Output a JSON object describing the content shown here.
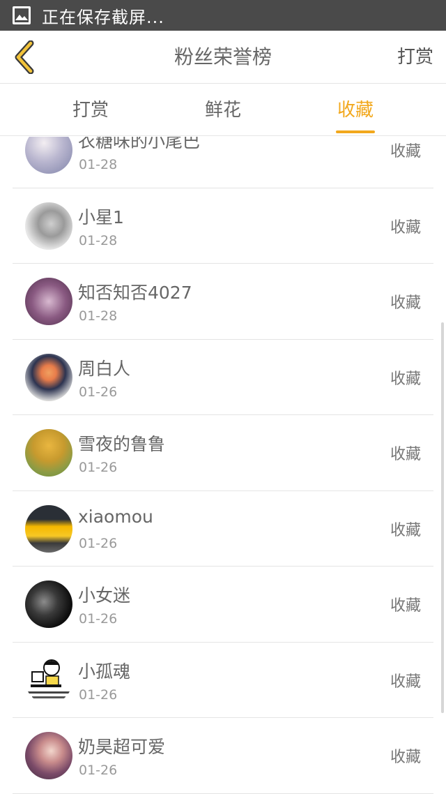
{
  "status_bar": {
    "text": "正在保存截屏...",
    "icon": "screenshot-icon"
  },
  "header": {
    "back_icon": "chevron-left-icon",
    "title": "粉丝荣誉榜",
    "action": "打赏"
  },
  "tabs": [
    {
      "label": "打赏",
      "active": false
    },
    {
      "label": "鲜花",
      "active": false
    },
    {
      "label": "收藏",
      "active": true
    }
  ],
  "colors": {
    "accent": "#f2a81d",
    "status_bar": "#4a4a4a"
  },
  "fans": [
    {
      "name": "衣糖味的小尾巴",
      "date": "01-28",
      "type": "收藏"
    },
    {
      "name": "小星1",
      "date": "01-28",
      "type": "收藏"
    },
    {
      "name": "知否知否4027",
      "date": "01-28",
      "type": "收藏"
    },
    {
      "name": "周白人",
      "date": "01-26",
      "type": "收藏"
    },
    {
      "name": "雪夜的鲁鲁",
      "date": "01-26",
      "type": "收藏"
    },
    {
      "name": "xiaomou",
      "date": "01-26",
      "type": "收藏"
    },
    {
      "name": "小女迷",
      "date": "01-26",
      "type": "收藏"
    },
    {
      "name": "小孤魂",
      "date": "01-26",
      "type": "收藏"
    },
    {
      "name": "奶昊超可爱",
      "date": "01-26",
      "type": "收藏"
    }
  ]
}
